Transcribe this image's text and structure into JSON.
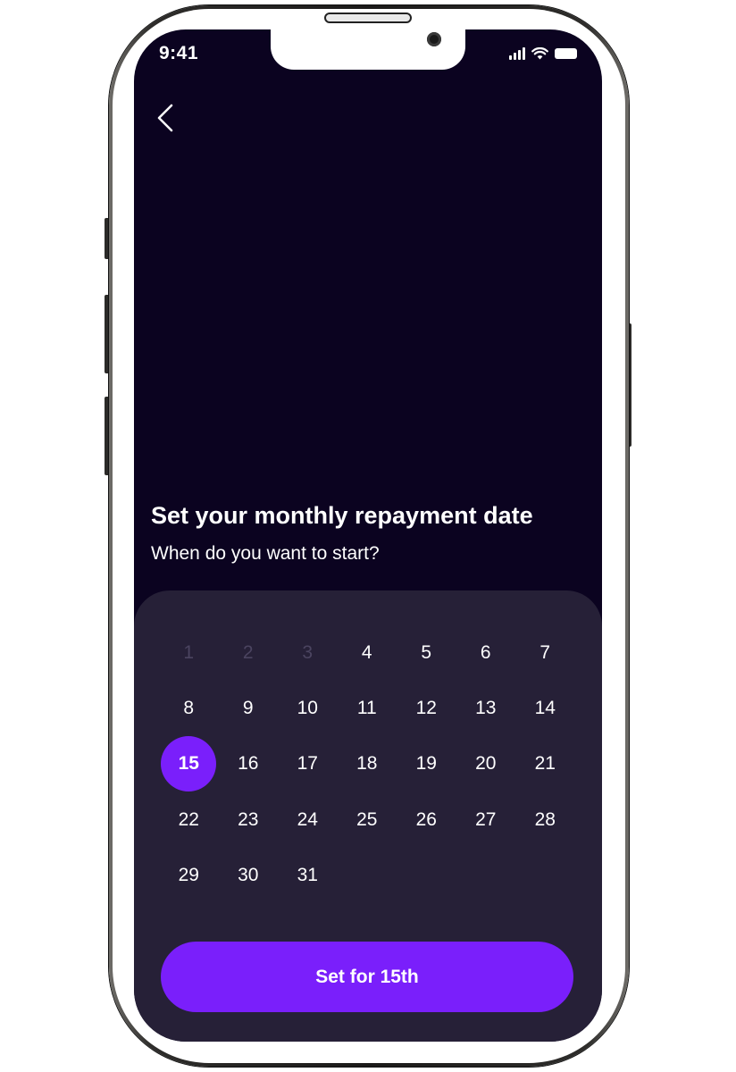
{
  "status_bar": {
    "time": "9:41",
    "icons": [
      "signal-icon",
      "wifi-icon",
      "battery-icon"
    ]
  },
  "header": {
    "back_icon": "chevron-left-icon"
  },
  "content": {
    "title": "Set your monthly repayment date",
    "subtitle": "When do you want to start?"
  },
  "calendar": {
    "days": [
      {
        "label": "1",
        "disabled": true
      },
      {
        "label": "2",
        "disabled": true
      },
      {
        "label": "3",
        "disabled": true
      },
      {
        "label": "4"
      },
      {
        "label": "5"
      },
      {
        "label": "6"
      },
      {
        "label": "7"
      },
      {
        "label": "8"
      },
      {
        "label": "9"
      },
      {
        "label": "10"
      },
      {
        "label": "11"
      },
      {
        "label": "12"
      },
      {
        "label": "13"
      },
      {
        "label": "14"
      },
      {
        "label": "15",
        "selected": true
      },
      {
        "label": "16"
      },
      {
        "label": "17"
      },
      {
        "label": "18"
      },
      {
        "label": "19"
      },
      {
        "label": "20"
      },
      {
        "label": "21"
      },
      {
        "label": "22"
      },
      {
        "label": "23"
      },
      {
        "label": "24"
      },
      {
        "label": "25"
      },
      {
        "label": "26"
      },
      {
        "label": "27"
      },
      {
        "label": "28"
      },
      {
        "label": "29"
      },
      {
        "label": "30"
      },
      {
        "label": "31"
      }
    ]
  },
  "confirm": {
    "label": "Set for 15th"
  },
  "colors": {
    "background": "#0b0320",
    "sheet": "#262037",
    "accent": "#7a1ffb",
    "disabled_text": "#4b4460"
  }
}
